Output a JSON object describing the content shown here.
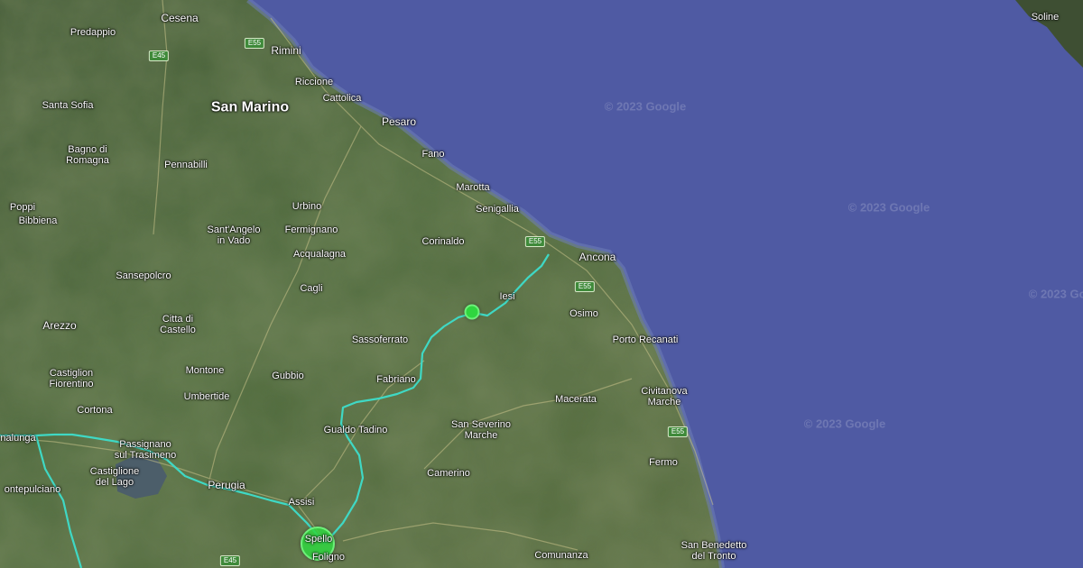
{
  "map": {
    "attribution": "© 2023 Google",
    "places": {
      "cesena": "Cesena",
      "predappio": "Predappio",
      "rimini": "Rimini",
      "riccione": "Riccione",
      "cattolica": "Cattolica",
      "san_marino": "San Marino",
      "santa_sofia": "Santa Sofia",
      "pesaro": "Pesaro",
      "bagno_di_romagna": "Bagno di\nRomagna",
      "pennabilli": "Pennabilli",
      "fano": "Fano",
      "marotta": "Marotta",
      "senigallia": "Senigallia",
      "poppi": "Poppi",
      "bibbiena": "Bibbiena",
      "urbino": "Urbino",
      "fermignano": "Fermignano",
      "santangelo_in_vado": "Sant'Angelo\nin Vado",
      "corinaldo": "Corinaldo",
      "ancona": "Ancona",
      "acqualagna": "Acqualagna",
      "sansepolcro": "Sansepolcro",
      "cagli": "Cagli",
      "iesi": "Iesi",
      "osimo": "Osimo",
      "arezzo": "Arezzo",
      "citta_di_castello": "Citta di\nCastello",
      "sassoferrato": "Sassoferrato",
      "porto_recanati": "Porto Recanati",
      "castiglion_fiorentino": "Castiglion\nFiorentino",
      "montone": "Montone",
      "gubbio": "Gubbio",
      "fabriano": "Fabriano",
      "umbertide": "Umbertide",
      "macerata": "Macerata",
      "civitanova_marche": "Civitanova\nMarche",
      "cortona": "Cortona",
      "gualdo_tadino": "Gualdo Tadino",
      "san_severino_marche": "San Severino\nMarche",
      "sinalunga": "nalunga",
      "passignano": "Passignano\nsul Trasimeno",
      "fermo": "Fermo",
      "castiglione_del_lago": "Castiglione\ndel Lago",
      "camerino": "Camerino",
      "perugia": "Perugia",
      "montepulciano": "ontepulciano",
      "assisi": "Assisi",
      "spello": "Spello",
      "foligno": "Foligno",
      "comunanza": "Comunanza",
      "san_benedetto": "San Benedetto\ndel Tronto",
      "soline": "Soline"
    },
    "roads": {
      "e45": "E45",
      "e55": "E55"
    },
    "colors": {
      "sea": "#4f5aa3",
      "land": "#445c36",
      "route": "#3fd8c4",
      "marker": "#2fd63f"
    }
  }
}
